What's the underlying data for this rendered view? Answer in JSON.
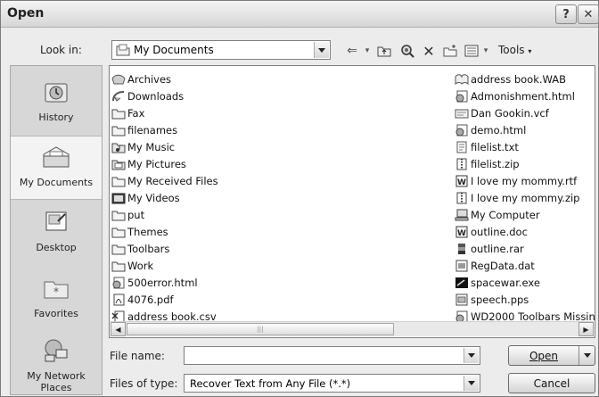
{
  "window": {
    "title": "Open"
  },
  "toolbar": {
    "look_in_label": "Look in:",
    "look_in_value": "My Documents",
    "tools_label": "Tools",
    "icons": [
      "back-icon",
      "up-folder-icon",
      "search-web-icon",
      "delete-icon",
      "new-folder-icon",
      "views-icon"
    ]
  },
  "places": [
    {
      "label": "History",
      "icon": "history-icon"
    },
    {
      "label": "My Documents",
      "icon": "my-documents-icon",
      "selected": true
    },
    {
      "label": "Desktop",
      "icon": "desktop-icon"
    },
    {
      "label": "Favorites",
      "icon": "favorites-icon"
    },
    {
      "label": "My Network Places",
      "icon": "network-places-icon"
    }
  ],
  "files_left": [
    {
      "name": "Archives",
      "icon": "special-folder-icon"
    },
    {
      "name": "Downloads",
      "icon": "special-folder-icon"
    },
    {
      "name": "Fax",
      "icon": "folder-icon"
    },
    {
      "name": "filenames",
      "icon": "folder-icon"
    },
    {
      "name": "My Music",
      "icon": "music-folder-icon"
    },
    {
      "name": "My Pictures",
      "icon": "pictures-folder-icon"
    },
    {
      "name": "My Received Files",
      "icon": "folder-icon"
    },
    {
      "name": "My Videos",
      "icon": "video-folder-icon"
    },
    {
      "name": "put",
      "icon": "folder-icon"
    },
    {
      "name": "Themes",
      "icon": "folder-icon"
    },
    {
      "name": "Toolbars",
      "icon": "folder-icon"
    },
    {
      "name": "Work",
      "icon": "folder-icon"
    },
    {
      "name": "500error.html",
      "icon": "html-file-icon"
    },
    {
      "name": "4076.pdf",
      "icon": "pdf-file-icon"
    },
    {
      "name": "address book.csv",
      "icon": "csv-file-icon"
    }
  ],
  "files_right": [
    {
      "name": "address book.WAB",
      "icon": "wab-file-icon"
    },
    {
      "name": "Admonishment.html",
      "icon": "html-file-icon"
    },
    {
      "name": "Dan Gookin.vcf",
      "icon": "vcf-file-icon"
    },
    {
      "name": "demo.html",
      "icon": "html-file-icon"
    },
    {
      "name": "filelist.txt",
      "icon": "txt-file-icon"
    },
    {
      "name": "filelist.zip",
      "icon": "zip-file-icon"
    },
    {
      "name": "I love my mommy.rtf",
      "icon": "word-file-icon"
    },
    {
      "name": "I love my mommy.zip",
      "icon": "zip-file-icon"
    },
    {
      "name": "My Computer",
      "icon": "my-computer-icon"
    },
    {
      "name": "outline.doc",
      "icon": "word-file-icon"
    },
    {
      "name": "outline.rar",
      "icon": "rar-file-icon"
    },
    {
      "name": "RegData.dat",
      "icon": "dat-file-icon"
    },
    {
      "name": "spacewar.exe",
      "icon": "exe-file-icon"
    },
    {
      "name": "speech.pps",
      "icon": "pps-file-icon"
    },
    {
      "name": "WD2000 Toolbars Missin",
      "icon": "html-file-icon"
    }
  ],
  "form": {
    "file_name_label": "File name:",
    "file_name_value": "",
    "file_type_label": "Files of type:",
    "file_type_value": "Recover Text from Any File (*.*)",
    "open_label": "Open",
    "cancel_label": "Cancel"
  }
}
